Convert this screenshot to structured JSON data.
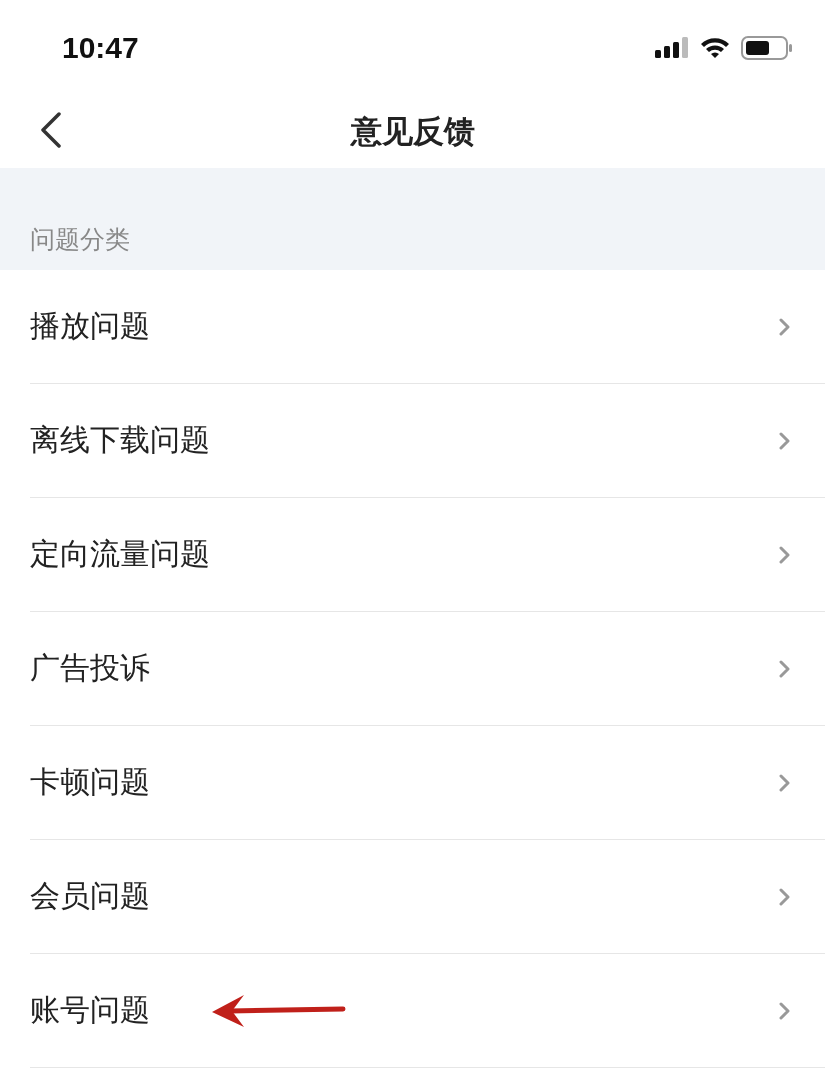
{
  "status_bar": {
    "time": "10:47"
  },
  "nav": {
    "title": "意见反馈"
  },
  "section": {
    "label": "问题分类"
  },
  "items": [
    {
      "label": "播放问题",
      "annotated": false
    },
    {
      "label": "离线下载问题",
      "annotated": false
    },
    {
      "label": "定向流量问题",
      "annotated": false
    },
    {
      "label": "广告投诉",
      "annotated": false
    },
    {
      "label": "卡顿问题",
      "annotated": false
    },
    {
      "label": "会员问题",
      "annotated": false
    },
    {
      "label": "账号问题",
      "annotated": true
    }
  ]
}
